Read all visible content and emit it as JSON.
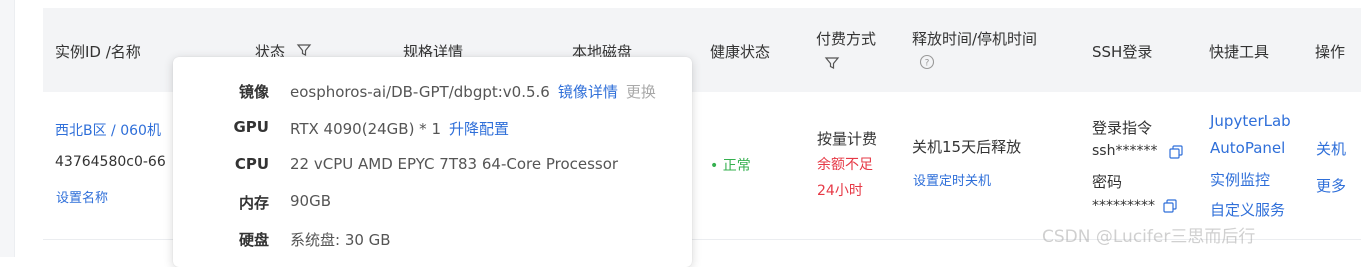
{
  "header": {
    "instance": "实例ID /名称",
    "status": "状态",
    "spec": "规格详情",
    "disk": "本地磁盘",
    "health": "健康状态",
    "billing": "付费方式",
    "release": "释放时间/停机时间",
    "ssh": "SSH登录",
    "tools": "快捷工具",
    "ops": "操作"
  },
  "row": {
    "region": "西北B区 / 060机",
    "instance_id": "43764580c0-66",
    "set_name": "设置名称",
    "health": "• 正常",
    "billing_type": "按量计费",
    "billing_warn1": "余额不足",
    "billing_warn2": "24小时",
    "release_text": "关机15天后释放",
    "set_shutdown": "设置定时关机",
    "ssh_cmd_label": "登录指令",
    "ssh_cmd": "ssh******",
    "password_label": "密码",
    "password": "*********",
    "tools": [
      "JupyterLab",
      "AutoPanel",
      "实例监控",
      "自定义服务"
    ],
    "ops": [
      "关机",
      "更多"
    ]
  },
  "popover": {
    "image_label": "镜像",
    "image_value": "eosphoros-ai/DB-GPT/dbgpt:v0.5.6",
    "image_detail": "镜像详情",
    "image_change": "更换",
    "gpu_label": "GPU",
    "gpu_value": "RTX 4090(24GB) * 1",
    "gpu_upgrade": "升降配置",
    "cpu_label": "CPU",
    "cpu_value": "22 vCPU AMD EPYC 7T83 64-Core Processor",
    "mem_label": "内存",
    "mem_value": "90GB",
    "disk_label": "硬盘",
    "disk_value": "系统盘: 30 GB"
  },
  "watermark": "CSDN @Lucifer三思而后行",
  "colors": {
    "link": "#2f6fd9",
    "danger": "#e63946",
    "success": "#35b04f",
    "header_bg": "#f3f4f6"
  },
  "icons": [
    "filter-icon",
    "help-circle-icon",
    "copy-icon"
  ]
}
